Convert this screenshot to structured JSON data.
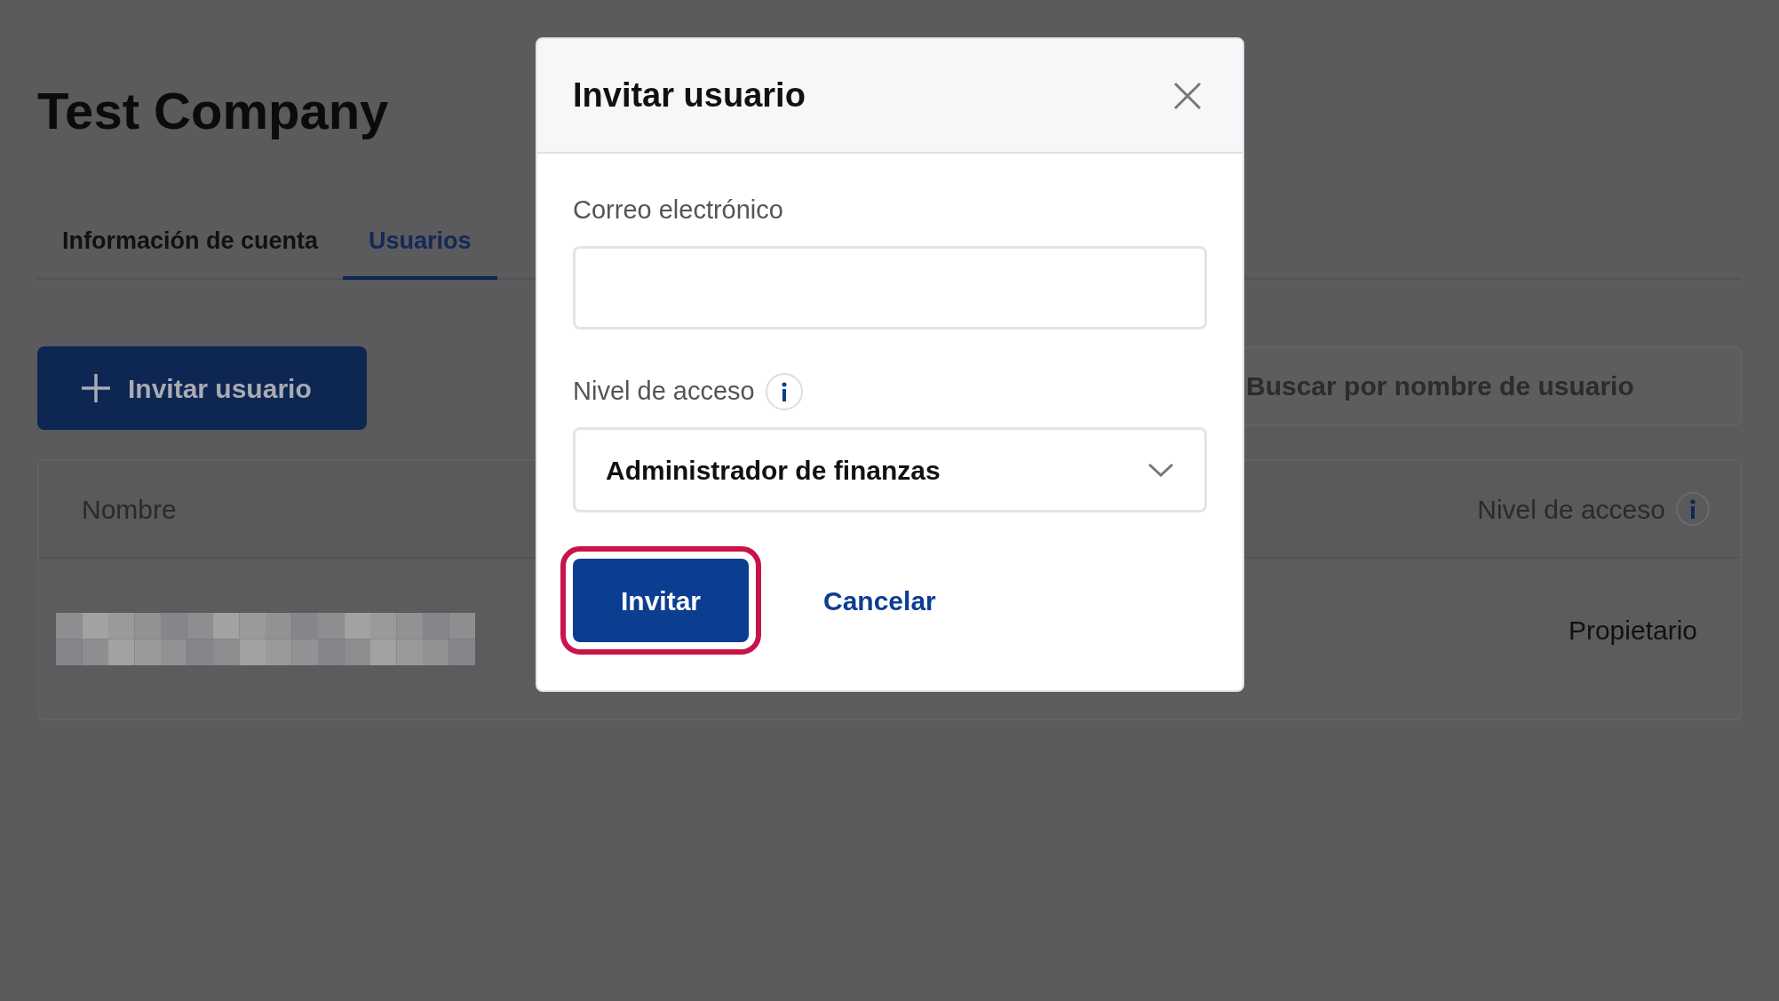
{
  "page": {
    "title": "Test Company",
    "tabs": [
      {
        "label": "Información de cuenta",
        "selected": false
      },
      {
        "label": "Usuarios",
        "selected": true
      }
    ],
    "invite_button": "Invitar usuario",
    "search": {
      "placeholder": "Buscar por nombre de usuario"
    },
    "table": {
      "columns": [
        "Nombre",
        "Nivel de acceso"
      ],
      "rows": [
        {
          "access": "Propietario"
        }
      ]
    }
  },
  "dialog": {
    "title": "Invitar usuario",
    "fields": [
      {
        "kind": "text",
        "label": "Correo electrónico"
      },
      {
        "kind": "select",
        "label": "Nivel de acceso",
        "value": "Administrador de finanzas"
      }
    ],
    "buttons": [
      {
        "kind": "primary",
        "label": "Invitar",
        "highlighted": true
      },
      {
        "kind": "link",
        "label": "Cancelar",
        "highlighted": false
      }
    ]
  }
}
